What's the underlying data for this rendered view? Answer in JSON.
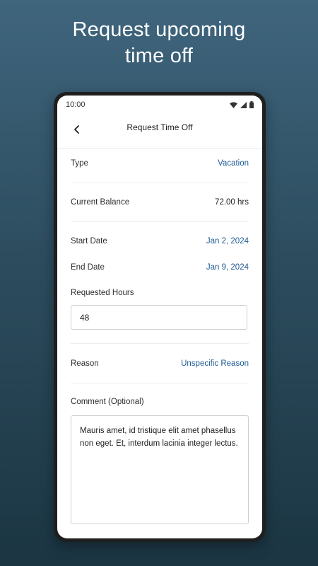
{
  "headline": {
    "line1": "Request upcoming",
    "line2": "time off"
  },
  "status_bar": {
    "time": "10:00",
    "icons": [
      "wifi-icon",
      "signal-icon",
      "battery-icon"
    ]
  },
  "app_bar": {
    "title": "Request Time Off",
    "back_icon": "chevron-left-icon"
  },
  "form": {
    "type": {
      "label": "Type",
      "value": "Vacation"
    },
    "current_balance": {
      "label": "Current Balance",
      "value": "72.00 hrs"
    },
    "start_date": {
      "label": "Start Date",
      "value": "Jan 2, 2024"
    },
    "end_date": {
      "label": "End Date",
      "value": "Jan 9, 2024"
    },
    "requested_hours": {
      "label": "Requested Hours",
      "value": "48"
    },
    "reason": {
      "label": "Reason",
      "value": "Unspecific Reason"
    },
    "comment": {
      "label": "Comment (Optional)",
      "value": "Mauris amet, id tristique elit amet phasellus non eget. Et, interdum lacinia integer lectus."
    }
  },
  "colors": {
    "background_top": "#3f657d",
    "background_bottom": "#1b3542",
    "accent_link": "#1e5a93",
    "phone_frame": "#1f1f1f"
  }
}
